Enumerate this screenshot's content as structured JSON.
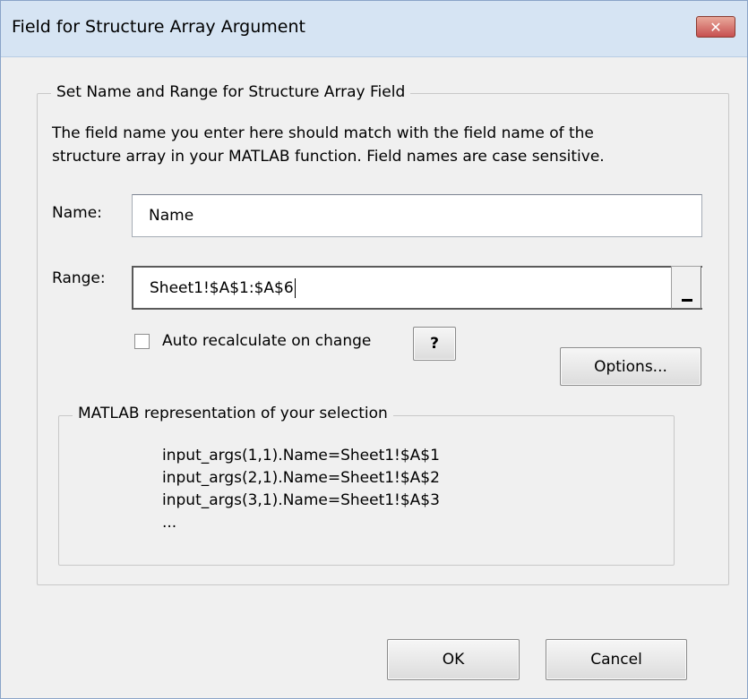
{
  "window": {
    "title": "Field for Structure Array Argument",
    "close_glyph": "✕"
  },
  "name_range_group": {
    "legend": "Set Name and Range for Structure Array Field",
    "description_line1": "The field name you enter here should match with the field name of the",
    "description_line2": "structure array in your MATLAB function. Field names are case sensitive.",
    "name_label": "Name:",
    "name_value": "Name",
    "range_label": "Range:",
    "range_value": "Sheet1!$A$1:$A$6",
    "auto_recalc_label": "Auto recalculate on change",
    "auto_recalc_checked": false,
    "help_label": "?",
    "options_label": "Options..."
  },
  "representation_group": {
    "legend": "MATLAB representation of your selection",
    "lines": [
      "input_args(1,1).Name=Sheet1!$A$1",
      "input_args(2,1).Name=Sheet1!$A$2",
      "input_args(3,1).Name=Sheet1!$A$3",
      "..."
    ]
  },
  "footer": {
    "ok_label": "OK",
    "cancel_label": "Cancel"
  },
  "colors": {
    "titlebar": "#d6e4f3",
    "close_button": "#c75050",
    "dialog_background": "#f0f0f0"
  }
}
